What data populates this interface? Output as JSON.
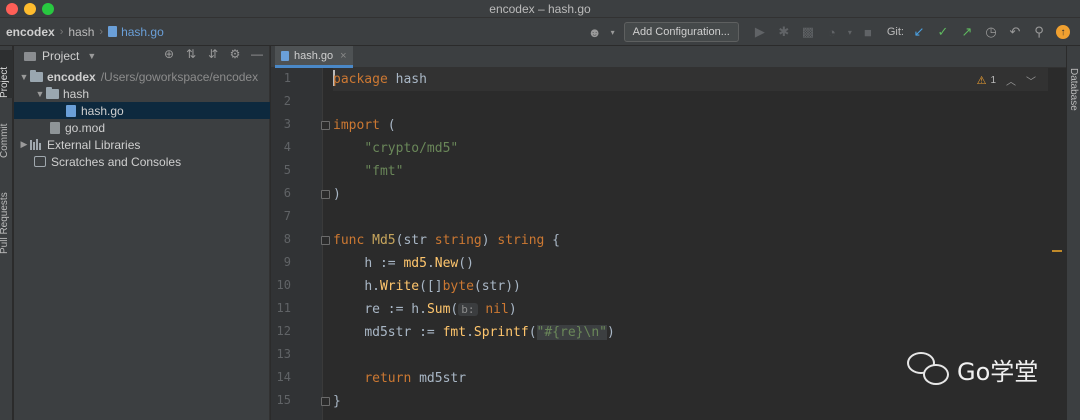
{
  "window": {
    "title": "encodex – hash.go"
  },
  "breadcrumbs": [
    "encodex",
    "hash",
    "hash.go"
  ],
  "toolbar": {
    "add_config_label": "Add Configuration...",
    "git_label": "Git:"
  },
  "left_tool_tabs": [
    "Project",
    "Commit",
    "Pull Requests"
  ],
  "right_tool_tabs": [
    "Database"
  ],
  "project_panel": {
    "title": "Project",
    "tree": [
      {
        "name": "encodex",
        "path": "/Users/goworkspace/encodex"
      },
      {
        "name": "hash"
      },
      {
        "name": "hash.go"
      },
      {
        "name": "go.mod"
      },
      {
        "name": "External Libraries"
      },
      {
        "name": "Scratches and Consoles"
      }
    ]
  },
  "editor": {
    "tab_label": "hash.go",
    "warning_count": "1",
    "line_numbers": [
      "1",
      "2",
      "3",
      "4",
      "5",
      "6",
      "7",
      "8",
      "9",
      "10",
      "11",
      "12",
      "13",
      "14",
      "15"
    ],
    "code": {
      "l1_kw": "package",
      "l1_rest": " hash",
      "l3_kw": "import",
      "l3_rest": " (",
      "l4_str": "\"crypto/md5\"",
      "l5_str": "\"fmt\"",
      "l6": ")",
      "l8_kw1": "func",
      "l8_name": "Md5",
      "l8_a": "(str ",
      "l8_kw2": "string",
      "l8_b": ") ",
      "l8_kw3": "string",
      "l8_c": " {",
      "l9_a": "h := ",
      "l9_pkg": "md5",
      "l9_dot": ".",
      "l9_fn": "New",
      "l9_b": "()",
      "l10_a": "h.",
      "l10_fn": "Write",
      "l10_b": "([]",
      "l10_kw": "byte",
      "l10_c": "(str))",
      "l11_a": "re := h.",
      "l11_fn": "Sum",
      "l11_b": "(",
      "l11_hint": "b:",
      "l11_kw": "nil",
      "l11_c": ")",
      "l12_a": "md5str := ",
      "l12_pkg": "fmt",
      "l12_dot": ".",
      "l12_fn": "Sprintf",
      "l12_b": "(",
      "l12_str": "\"#{re}\\n\"",
      "l12_c": ")",
      "l14_kw": "return",
      "l14_rest": " md5str",
      "l15": "}"
    }
  },
  "watermark": {
    "text": "Go学堂",
    "logo_icon": "wechat-logo"
  },
  "colors": {
    "keyword": "#cc7832",
    "string": "#6a8759",
    "function": "#ffc66d",
    "selection": "#0d293e",
    "tab_underline": "#4a88c7"
  }
}
